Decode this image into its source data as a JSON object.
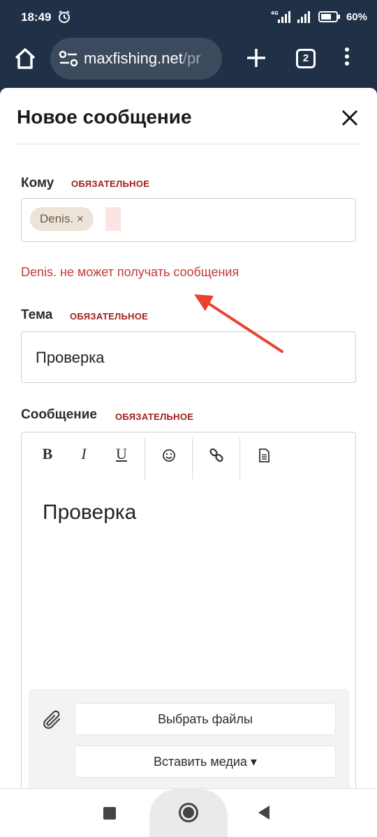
{
  "status_bar": {
    "time": "18:49",
    "battery": "60%",
    "network": "4G"
  },
  "browser": {
    "url_host": "maxfishing.net",
    "url_path": "/pr",
    "tab_count": "2"
  },
  "modal": {
    "title": "Новое сообщение"
  },
  "recipient": {
    "label": "Кому",
    "required": "ОБЯЗАТЕЛЬНОЕ",
    "token": "Denis. ×",
    "error": "Denis. не может получать сообщения"
  },
  "subject": {
    "label": "Тема",
    "required": "ОБЯЗАТЕЛЬНОЕ",
    "value": "Проверка"
  },
  "message": {
    "label": "Сообщение",
    "required": "ОБЯЗАТЕЛЬНОЕ",
    "toolbar": {
      "bold": "B",
      "italic": "I",
      "underline": "U"
    },
    "body": "Проверка"
  },
  "attachments": {
    "choose_files": "Выбрать файлы",
    "insert_media": "Вставить медиа ▾"
  },
  "colors": {
    "header_bg": "#1f3047",
    "required_red": "#a02020",
    "error_red": "#c23a3a",
    "arrow_red": "#e8432e"
  }
}
